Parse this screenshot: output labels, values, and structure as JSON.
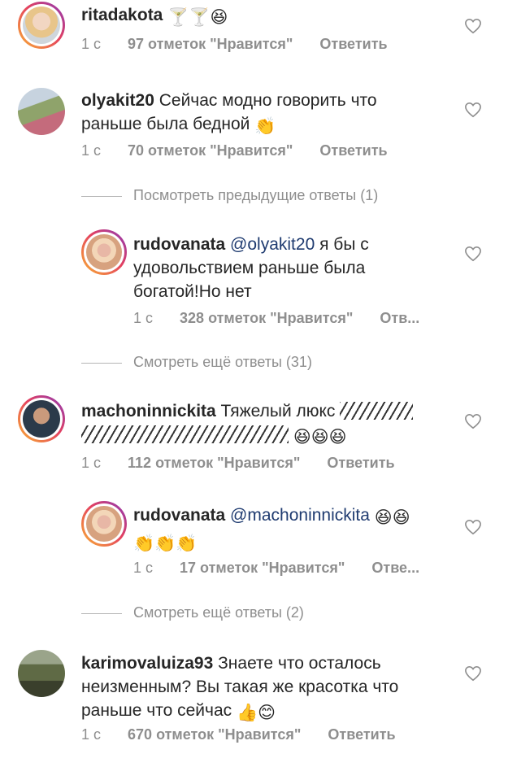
{
  "comments": [
    {
      "username": "ritadakota",
      "text": "",
      "emoji": [
        "🍸",
        "🍸",
        "😆"
      ],
      "time": "1 с",
      "likes": "97 отметок \"Нравится\"",
      "reply": "Ответить"
    },
    {
      "username": "olyakit20",
      "text": "Сейчас модно говорить что раньше была бедной",
      "emoji": [
        "👏"
      ],
      "time": "1 с",
      "likes": "70 отметок \"Нравится\"",
      "reply": "Ответить",
      "thread_label": "Посмотреть предыдущие ответы (1)",
      "replies": [
        {
          "username": "rudovanata",
          "mention": "@olyakit20",
          "text": "я бы с удовольствием раньше была богатой!Но нет",
          "time": "1 с",
          "likes": "328 отметок \"Нравится\"",
          "reply": "Отв..."
        }
      ],
      "more_label": "Смотреть ещё ответы (31)"
    },
    {
      "username": "machoninnickita",
      "text": "Тяжелый люкс",
      "emoji": [
        "😆",
        "😆",
        "😆"
      ],
      "time": "1 с",
      "likes": "112 отметок \"Нравится\"",
      "reply": "Ответить",
      "replies": [
        {
          "username": "rudovanata",
          "mention": "@machoninnickita",
          "emoji": [
            "😆",
            "😆",
            "👏",
            "👏",
            "👏"
          ],
          "time": "1 с",
          "likes": "17 отметок \"Нравится\"",
          "reply": "Отве..."
        }
      ],
      "more_label": "Смотреть ещё ответы (2)"
    },
    {
      "username": "karimovaluiza93",
      "text": "Знаете что осталось неизменным? Вы такая же красотка что раньше что сейчас",
      "emoji": [
        "👍",
        "😊"
      ],
      "time": "1 с",
      "likes": "670 отметок \"Нравится\"",
      "reply": "Ответить"
    }
  ],
  "icons": {
    "heart": "heart-outline-icon",
    "accent": "#e4405f",
    "meta_color": "#8e8e8e",
    "mention_color": "#1f3b70"
  }
}
